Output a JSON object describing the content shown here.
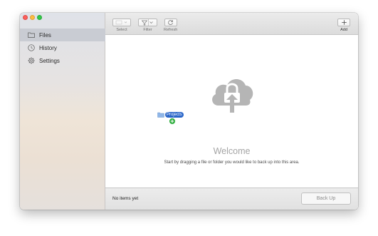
{
  "window": {
    "controls": [
      "close",
      "minimize",
      "zoom"
    ]
  },
  "sidebar": {
    "items": [
      {
        "label": "Files",
        "icon": "folder-icon",
        "active": true
      },
      {
        "label": "History",
        "icon": "clock-icon",
        "active": false
      },
      {
        "label": "Settings",
        "icon": "gear-icon",
        "active": false
      }
    ]
  },
  "toolbar": {
    "select_label": "Select",
    "filter_label": "Filter",
    "refresh_label": "Refresh",
    "add_label": "Add"
  },
  "content": {
    "welcome": "Welcome",
    "hint": "Start by dragging a file or folder you would like to back up into this area.",
    "dragged_item_label": "Projects"
  },
  "status": {
    "text": "No items yet",
    "backup_button": "Back Up"
  },
  "colors": {
    "sidebar_selection": "#c9ccd3",
    "drag_label": "#2a66c9",
    "drag_plus": "#2fae3e",
    "cloud_icon": "#b5b5b5"
  }
}
